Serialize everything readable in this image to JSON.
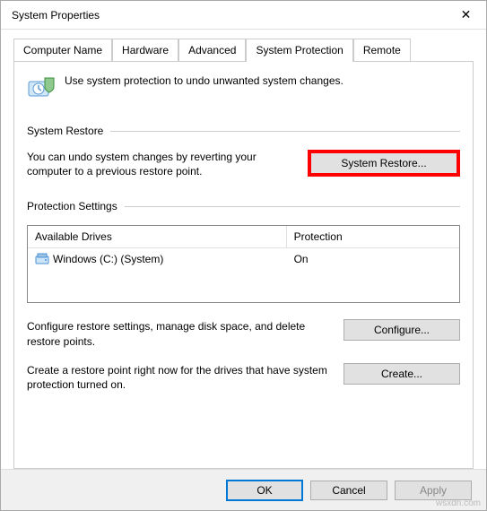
{
  "window": {
    "title": "System Properties"
  },
  "tabs": {
    "computer_name": "Computer Name",
    "hardware": "Hardware",
    "advanced": "Advanced",
    "system_protection": "System Protection",
    "remote": "Remote"
  },
  "intro": "Use system protection to undo unwanted system changes.",
  "sections": {
    "restore": "System Restore",
    "protection": "Protection Settings"
  },
  "restore": {
    "text": "You can undo system changes by reverting your computer to a previous restore point.",
    "button": "System Restore..."
  },
  "drives_table": {
    "col_drives": "Available Drives",
    "col_protection": "Protection",
    "rows": [
      {
        "name": "Windows (C:) (System)",
        "protection": "On"
      }
    ]
  },
  "configure": {
    "text": "Configure restore settings, manage disk space, and delete restore points.",
    "button": "Configure..."
  },
  "create": {
    "text": "Create a restore point right now for the drives that have system protection turned on.",
    "button": "Create..."
  },
  "dialog": {
    "ok": "OK",
    "cancel": "Cancel",
    "apply": "Apply"
  },
  "watermark": "wsxdn.com"
}
